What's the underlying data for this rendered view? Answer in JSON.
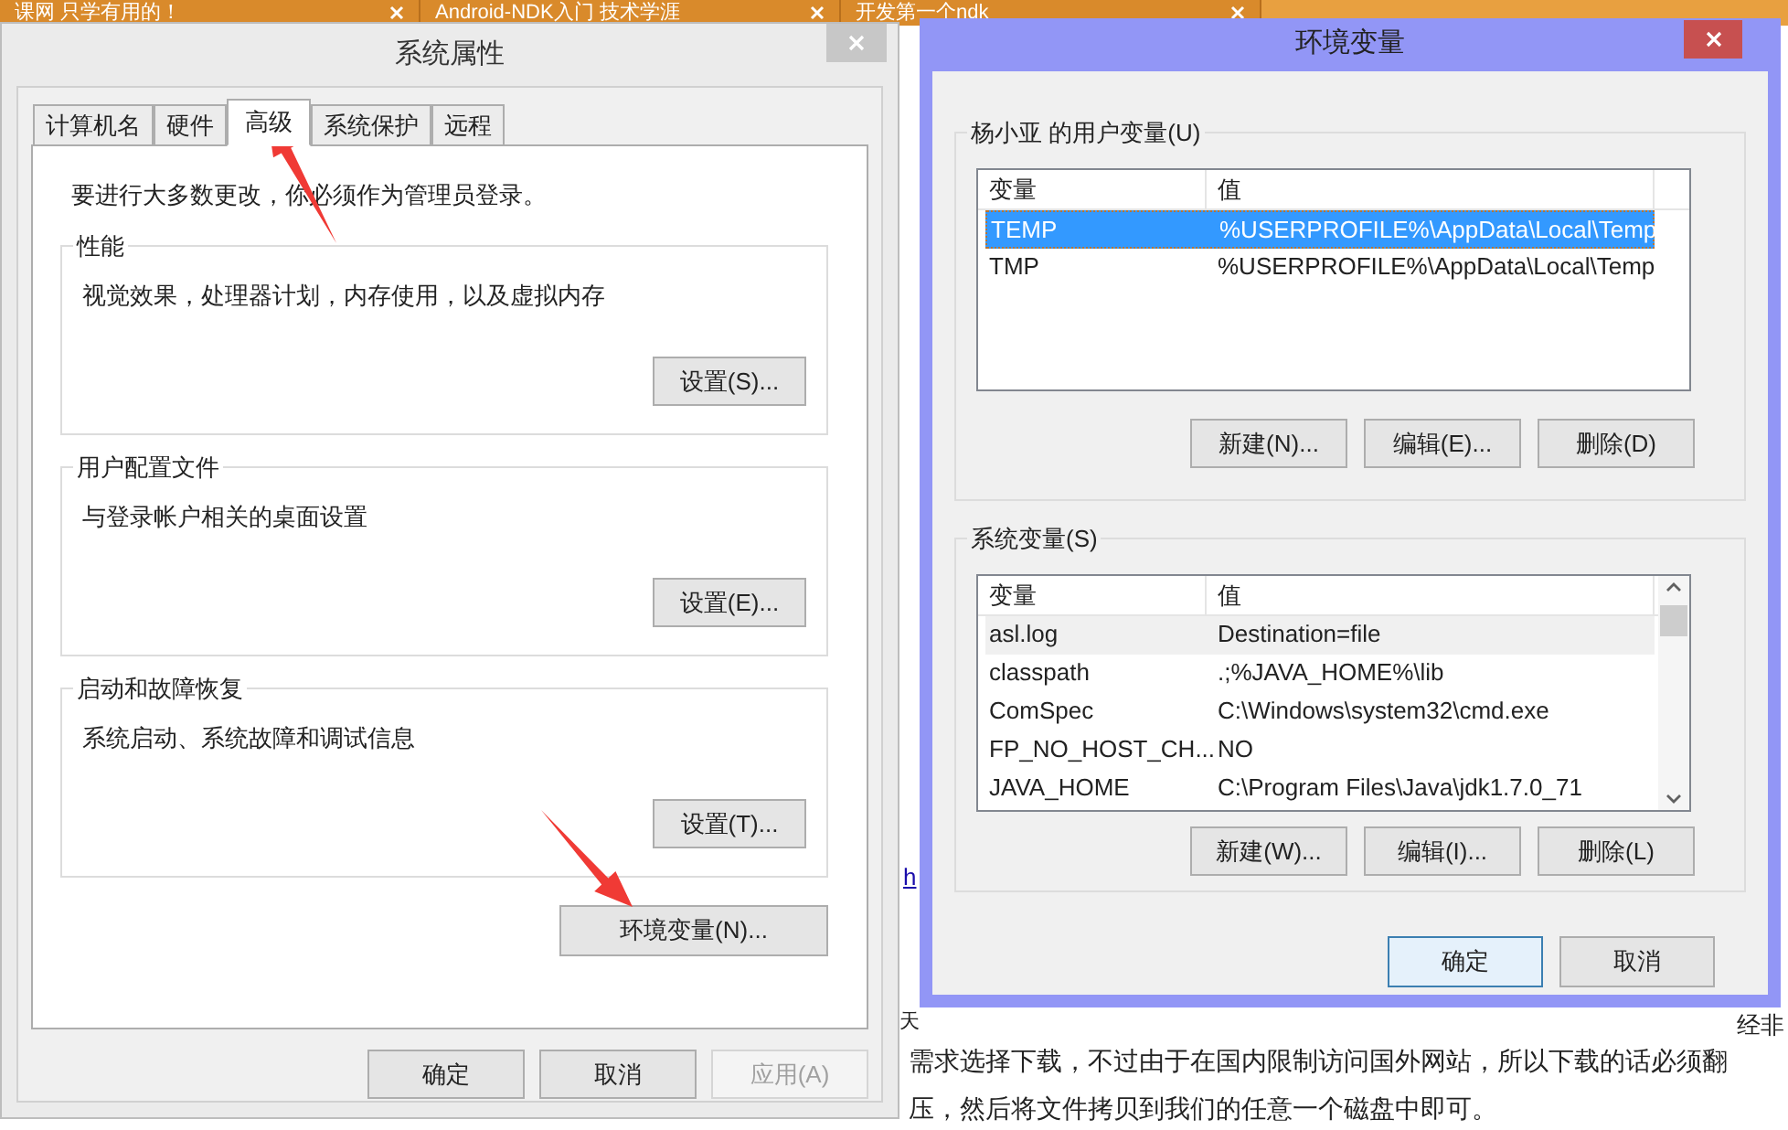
{
  "browser_tabs": [
    {
      "title": "课网 只学有用的！"
    },
    {
      "title": "Android-NDK入门 技术学涯"
    },
    {
      "title": "开发第一个ndk"
    }
  ],
  "background_page": {
    "link": "h",
    "line_start": "天",
    "line_end": "经非",
    "lines": [
      "需求选择下载，不过由于在国内限制访问国外网站，所以下载的话必须翻",
      "压，然后将文件拷贝到我们的任意一个磁盘中即可。"
    ]
  },
  "system_properties": {
    "title": "系统属性",
    "tabs": [
      {
        "label": "计算机名",
        "selected": false
      },
      {
        "label": "硬件",
        "selected": false
      },
      {
        "label": "高级",
        "selected": true
      },
      {
        "label": "系统保护",
        "selected": false
      },
      {
        "label": "远程",
        "selected": false
      }
    ],
    "notice": "要进行大多数更改，你必须作为管理员登录。",
    "groups": [
      {
        "title": "性能",
        "description": "视觉效果，处理器计划，内存使用，以及虚拟内存",
        "button": "设置(S)..."
      },
      {
        "title": "用户配置文件",
        "description": "与登录帐户相关的桌面设置",
        "button": "设置(E)..."
      },
      {
        "title": "启动和故障恢复",
        "description": "系统启动、系统故障和调试信息",
        "button": "设置(T)..."
      }
    ],
    "env_button": "环境变量(N)...",
    "buttons": [
      {
        "label": "确定",
        "disabled": false
      },
      {
        "label": "取消",
        "disabled": false
      },
      {
        "label": "应用(A)",
        "disabled": true
      }
    ]
  },
  "environment_variables": {
    "title": "环境变量",
    "sections": [
      {
        "title": "杨小亚 的用户变量(U)",
        "has_focus": true,
        "scrollable": false,
        "columns": [
          "变量",
          "值"
        ],
        "rows": [
          {
            "name": "TEMP",
            "value": "%USERPROFILE%\\AppData\\Local\\Temp",
            "selected": true
          },
          {
            "name": "TMP",
            "value": "%USERPROFILE%\\AppData\\Local\\Temp",
            "selected": false
          }
        ],
        "buttons": [
          "新建(N)...",
          "编辑(E)...",
          "删除(D)"
        ]
      },
      {
        "title": "系统变量(S)",
        "has_focus": false,
        "scrollable": true,
        "columns": [
          "变量",
          "值"
        ],
        "rows": [
          {
            "name": "asl.log",
            "value": "Destination=file",
            "selected": true
          },
          {
            "name": "classpath",
            "value": ".;%JAVA_HOME%\\lib",
            "selected": false
          },
          {
            "name": "ComSpec",
            "value": "C:\\Windows\\system32\\cmd.exe",
            "selected": false
          },
          {
            "name": "FP_NO_HOST_CH...",
            "value": "NO",
            "selected": false
          },
          {
            "name": "JAVA_HOME",
            "value": "C:\\Program Files\\Java\\jdk1.7.0_71",
            "selected": false
          }
        ],
        "buttons": [
          "新建(W)...",
          "编辑(I)...",
          "删除(L)"
        ]
      }
    ],
    "buttons": [
      {
        "label": "确定",
        "focused": true
      },
      {
        "label": "取消",
        "focused": false
      }
    ]
  }
}
